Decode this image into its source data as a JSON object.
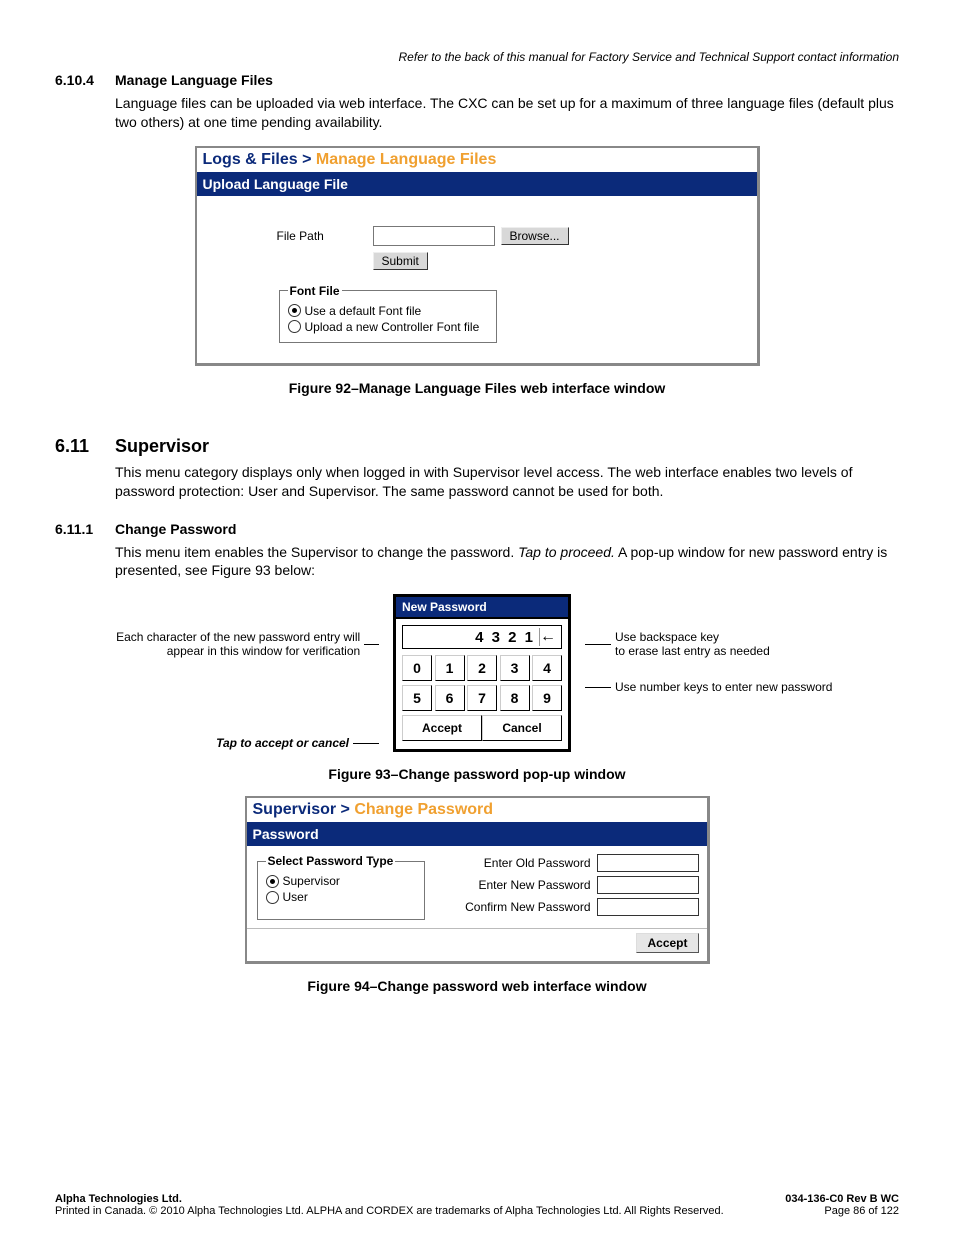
{
  "header_note": "Refer to the back of this manual for Factory Service and Technical Support contact information",
  "s6104": {
    "num": "6.10.4",
    "title": "Manage Language Files",
    "body": "Language files can be uploaded via web interface. The CXC can be set up for a maximum of three language files (default plus two others) at one time pending availability."
  },
  "fig92": {
    "crumb1": "Logs & Files > ",
    "crumb2": "Manage Language Files",
    "bar": "Upload Language File",
    "filepath_label": "File Path",
    "browse": "Browse...",
    "submit": "Submit",
    "fontfile_legend": "Font File",
    "radio1": "Use a default Font file",
    "radio2": "Upload a new Controller Font file",
    "caption": "Figure 92–Manage Language Files web interface window"
  },
  "s611": {
    "num": "6.11",
    "title": "Supervisor",
    "body": "This menu category displays only when logged in with Supervisor level access. The web interface enables two levels of password protection: User and Supervisor. The same password cannot be used for both."
  },
  "s6111": {
    "num": "6.11.1",
    "title": "Change Password",
    "body1": "This menu item enables the Supervisor to change the password. ",
    "body_em": "Tap to proceed.",
    "body2": " A pop-up window for new password entry is presented, see Figure 93 below:"
  },
  "fig93": {
    "title": "New Password",
    "display": "4 3 2 1",
    "backspace": "←",
    "keys_row1": [
      "0",
      "1",
      "2",
      "3",
      "4"
    ],
    "keys_row2": [
      "5",
      "6",
      "7",
      "8",
      "9"
    ],
    "accept": "Accept",
    "cancel": "Cancel",
    "call_left_top": "Each character of the new password entry will appear in this window for verification",
    "call_left_bot": "Tap to accept or cancel",
    "call_right_top1": "Use backspace key",
    "call_right_top2": "to erase last entry as needed",
    "call_right_bot": "Use number keys to enter new password",
    "caption": "Figure 93–Change password pop-up window"
  },
  "fig94": {
    "crumb1": "Supervisor > ",
    "crumb2": "Change Password",
    "bar": "Password",
    "legend": "Select Password Type",
    "radio1": "Supervisor",
    "radio2": "User",
    "old": "Enter Old Password",
    "new": "Enter New Password",
    "confirm": "Confirm New Password",
    "accept": "Accept",
    "caption": "Figure 94–Change password web interface window"
  },
  "footer": {
    "co": "Alpha Technologies Ltd.",
    "legal": "Printed in Canada.   © 2010 Alpha Technologies Ltd.  ALPHA and CORDEX are trademarks of Alpha Technologies Ltd.  All Rights Reserved.",
    "doc": "034-136-C0  Rev B  WC",
    "page": "Page 86 of 122"
  }
}
